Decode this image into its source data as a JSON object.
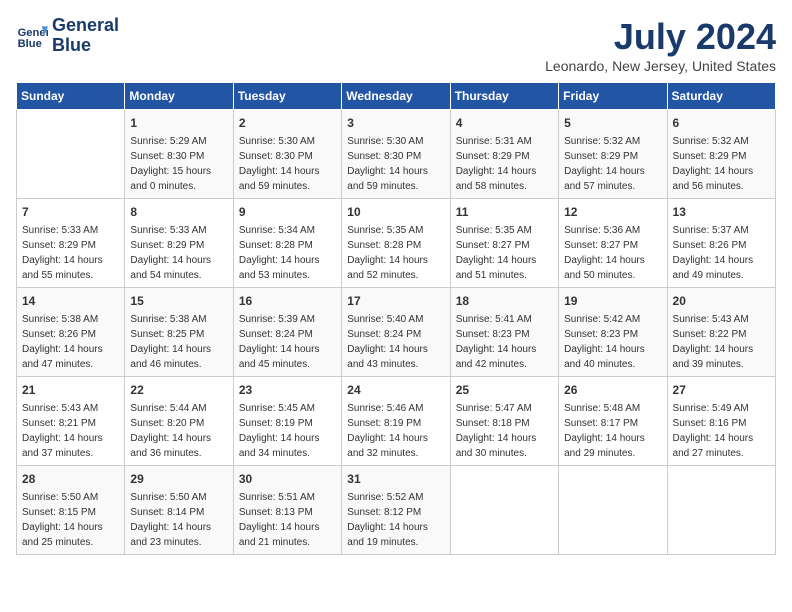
{
  "logo": {
    "line1": "General",
    "line2": "Blue"
  },
  "title": "July 2024",
  "location": "Leonardo, New Jersey, United States",
  "days_of_week": [
    "Sunday",
    "Monday",
    "Tuesday",
    "Wednesday",
    "Thursday",
    "Friday",
    "Saturday"
  ],
  "weeks": [
    [
      {
        "day": "",
        "info": ""
      },
      {
        "day": "1",
        "info": "Sunrise: 5:29 AM\nSunset: 8:30 PM\nDaylight: 15 hours\nand 0 minutes."
      },
      {
        "day": "2",
        "info": "Sunrise: 5:30 AM\nSunset: 8:30 PM\nDaylight: 14 hours\nand 59 minutes."
      },
      {
        "day": "3",
        "info": "Sunrise: 5:30 AM\nSunset: 8:30 PM\nDaylight: 14 hours\nand 59 minutes."
      },
      {
        "day": "4",
        "info": "Sunrise: 5:31 AM\nSunset: 8:29 PM\nDaylight: 14 hours\nand 58 minutes."
      },
      {
        "day": "5",
        "info": "Sunrise: 5:32 AM\nSunset: 8:29 PM\nDaylight: 14 hours\nand 57 minutes."
      },
      {
        "day": "6",
        "info": "Sunrise: 5:32 AM\nSunset: 8:29 PM\nDaylight: 14 hours\nand 56 minutes."
      }
    ],
    [
      {
        "day": "7",
        "info": "Sunrise: 5:33 AM\nSunset: 8:29 PM\nDaylight: 14 hours\nand 55 minutes."
      },
      {
        "day": "8",
        "info": "Sunrise: 5:33 AM\nSunset: 8:29 PM\nDaylight: 14 hours\nand 54 minutes."
      },
      {
        "day": "9",
        "info": "Sunrise: 5:34 AM\nSunset: 8:28 PM\nDaylight: 14 hours\nand 53 minutes."
      },
      {
        "day": "10",
        "info": "Sunrise: 5:35 AM\nSunset: 8:28 PM\nDaylight: 14 hours\nand 52 minutes."
      },
      {
        "day": "11",
        "info": "Sunrise: 5:35 AM\nSunset: 8:27 PM\nDaylight: 14 hours\nand 51 minutes."
      },
      {
        "day": "12",
        "info": "Sunrise: 5:36 AM\nSunset: 8:27 PM\nDaylight: 14 hours\nand 50 minutes."
      },
      {
        "day": "13",
        "info": "Sunrise: 5:37 AM\nSunset: 8:26 PM\nDaylight: 14 hours\nand 49 minutes."
      }
    ],
    [
      {
        "day": "14",
        "info": "Sunrise: 5:38 AM\nSunset: 8:26 PM\nDaylight: 14 hours\nand 47 minutes."
      },
      {
        "day": "15",
        "info": "Sunrise: 5:38 AM\nSunset: 8:25 PM\nDaylight: 14 hours\nand 46 minutes."
      },
      {
        "day": "16",
        "info": "Sunrise: 5:39 AM\nSunset: 8:24 PM\nDaylight: 14 hours\nand 45 minutes."
      },
      {
        "day": "17",
        "info": "Sunrise: 5:40 AM\nSunset: 8:24 PM\nDaylight: 14 hours\nand 43 minutes."
      },
      {
        "day": "18",
        "info": "Sunrise: 5:41 AM\nSunset: 8:23 PM\nDaylight: 14 hours\nand 42 minutes."
      },
      {
        "day": "19",
        "info": "Sunrise: 5:42 AM\nSunset: 8:23 PM\nDaylight: 14 hours\nand 40 minutes."
      },
      {
        "day": "20",
        "info": "Sunrise: 5:43 AM\nSunset: 8:22 PM\nDaylight: 14 hours\nand 39 minutes."
      }
    ],
    [
      {
        "day": "21",
        "info": "Sunrise: 5:43 AM\nSunset: 8:21 PM\nDaylight: 14 hours\nand 37 minutes."
      },
      {
        "day": "22",
        "info": "Sunrise: 5:44 AM\nSunset: 8:20 PM\nDaylight: 14 hours\nand 36 minutes."
      },
      {
        "day": "23",
        "info": "Sunrise: 5:45 AM\nSunset: 8:19 PM\nDaylight: 14 hours\nand 34 minutes."
      },
      {
        "day": "24",
        "info": "Sunrise: 5:46 AM\nSunset: 8:19 PM\nDaylight: 14 hours\nand 32 minutes."
      },
      {
        "day": "25",
        "info": "Sunrise: 5:47 AM\nSunset: 8:18 PM\nDaylight: 14 hours\nand 30 minutes."
      },
      {
        "day": "26",
        "info": "Sunrise: 5:48 AM\nSunset: 8:17 PM\nDaylight: 14 hours\nand 29 minutes."
      },
      {
        "day": "27",
        "info": "Sunrise: 5:49 AM\nSunset: 8:16 PM\nDaylight: 14 hours\nand 27 minutes."
      }
    ],
    [
      {
        "day": "28",
        "info": "Sunrise: 5:50 AM\nSunset: 8:15 PM\nDaylight: 14 hours\nand 25 minutes."
      },
      {
        "day": "29",
        "info": "Sunrise: 5:50 AM\nSunset: 8:14 PM\nDaylight: 14 hours\nand 23 minutes."
      },
      {
        "day": "30",
        "info": "Sunrise: 5:51 AM\nSunset: 8:13 PM\nDaylight: 14 hours\nand 21 minutes."
      },
      {
        "day": "31",
        "info": "Sunrise: 5:52 AM\nSunset: 8:12 PM\nDaylight: 14 hours\nand 19 minutes."
      },
      {
        "day": "",
        "info": ""
      },
      {
        "day": "",
        "info": ""
      },
      {
        "day": "",
        "info": ""
      }
    ]
  ]
}
